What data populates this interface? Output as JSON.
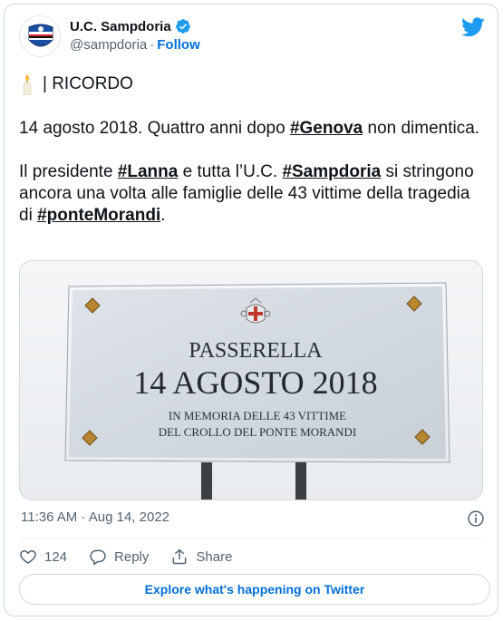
{
  "tweet": {
    "author": {
      "display_name": "U.C. Sampdoria",
      "handle": "@sampdoria",
      "separator": "·",
      "follow_label": "Follow"
    },
    "text": {
      "line1": "| RICORDO",
      "p1_a": "14 agosto 2018. Quattro anni dopo ",
      "p1_tag": "#Genova",
      "p1_b": " non dimentica.",
      "p2_a": "Il presidente ",
      "p2_tag1": "#Lanna",
      "p2_b": " e tutta l’U.C. ",
      "p2_tag2": "#Sampdoria",
      "p2_c": " si stringono ancora una volta alle famiglie delle 43 vittime della tragedia di ",
      "p2_tag3": "#ponteMorandi",
      "p2_d": "."
    },
    "media": {
      "plaque_line1": "PASSERELLA",
      "plaque_line2": "14 AGOSTO 2018",
      "plaque_line3": "IN MEMORIA DELLE 43 VITTIME",
      "plaque_line4": "DEL CROLLO DEL PONTE MORANDI"
    },
    "timestamp": "11:36 AM · Aug 14, 2022",
    "actions": {
      "like_count": "124",
      "reply_label": "Reply",
      "share_label": "Share"
    },
    "explore_label": "Explore what's happening on Twitter"
  },
  "colors": {
    "link_blue": "#006fd6",
    "twitter_blue": "#1d9bf0",
    "muted": "#536471",
    "border": "#cfd9de"
  },
  "icons": [
    "sampdoria-crest-avatar",
    "verified-badge-icon",
    "twitter-bird-icon",
    "candle-emoji",
    "info-icon",
    "heart-icon",
    "reply-icon",
    "share-icon"
  ]
}
